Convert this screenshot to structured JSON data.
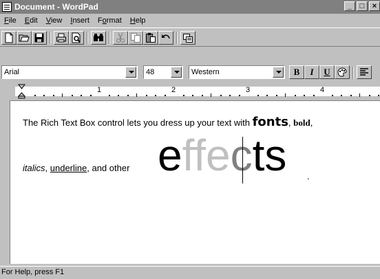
{
  "window": {
    "title": "Document - WordPad"
  },
  "menu": [
    {
      "label": "File",
      "key": "F",
      "rest": "ile"
    },
    {
      "label": "Edit",
      "key": "E",
      "rest": "dit"
    },
    {
      "label": "View",
      "key": "V",
      "rest": "iew"
    },
    {
      "label": "Insert",
      "key": "I",
      "rest": "nsert"
    },
    {
      "label": "Format",
      "pre": "F",
      "key": "o",
      "rest": "rmat"
    },
    {
      "label": "Help",
      "key": "H",
      "rest": "elp"
    }
  ],
  "format": {
    "font": "Arial",
    "size": "48",
    "script": "Western",
    "bold_label": "B",
    "italic_label": "I",
    "underline_label": "U"
  },
  "ruler": {
    "labels": [
      "1",
      "2",
      "3",
      "4"
    ]
  },
  "document": {
    "line1": {
      "plain": "The Rich Text Box control lets you dress up your text with ",
      "fonts": "fonts",
      "comma1": ", ",
      "bold": "bold",
      "comma2": ","
    },
    "line2": {
      "italics": "italics",
      "comma1": ", ",
      "underline": "underline",
      "rest": ", and other"
    },
    "big": {
      "e": "e",
      "ffe": "ffe",
      "c": "c",
      "ts": "ts"
    },
    "end_mark": "."
  },
  "status": {
    "text": "For Help, press F1"
  },
  "colors": {
    "titlebar": "#808080",
    "face": "#c0c0c0",
    "gray_text": "#c0c0c0"
  }
}
